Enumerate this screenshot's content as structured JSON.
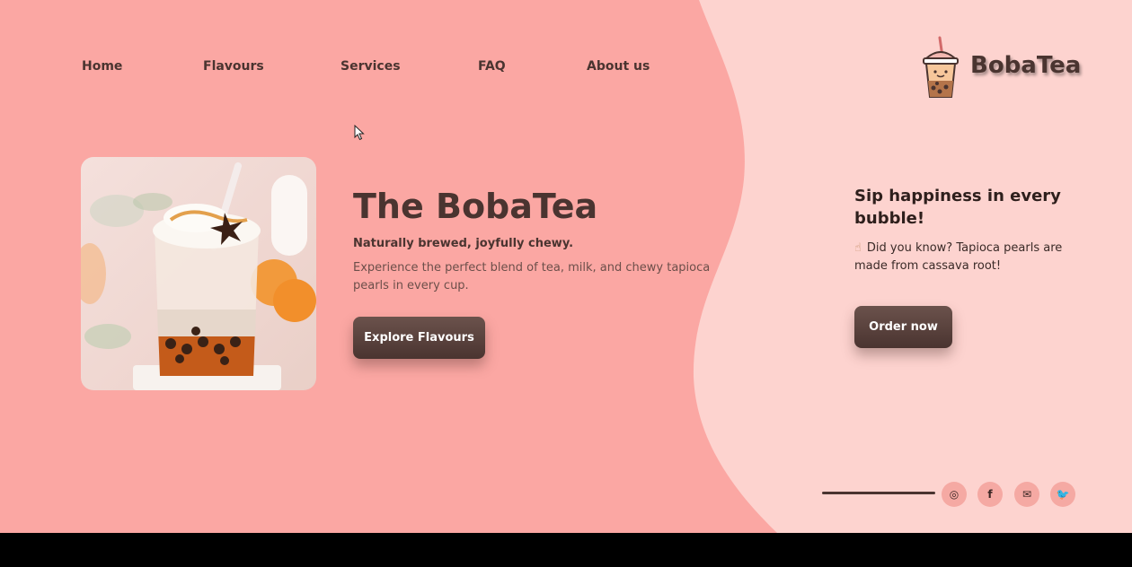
{
  "nav": {
    "items": [
      {
        "label": "Home"
      },
      {
        "label": "Flavours"
      },
      {
        "label": "Services"
      },
      {
        "label": "FAQ"
      },
      {
        "label": "About us"
      }
    ]
  },
  "brand": {
    "name": "BobaTea",
    "logo_icon": "boba-cup-icon"
  },
  "hero": {
    "title": "The BobaTea",
    "tagline": "Naturally brewed, joyfully chewy.",
    "description": "Experience the perfect blend of tea, milk, and chewy tapioca pearls in every cup.",
    "cta_label": "Explore Flavours",
    "image_icon": "bubble-tea-photo"
  },
  "side": {
    "heading": "Sip happiness in every bubble!",
    "fact_icon": "pointing-hand-icon",
    "fact": "Did you know? Tapioca pearls are made from cassava root!",
    "cta_label": "Order now"
  },
  "social": [
    {
      "name": "instagram-icon",
      "glyph": "◎"
    },
    {
      "name": "facebook-icon",
      "glyph": "f"
    },
    {
      "name": "email-icon",
      "glyph": "✉"
    },
    {
      "name": "twitter-icon",
      "glyph": "🐦"
    }
  ],
  "colors": {
    "background_pink": "#fba7a3",
    "panel_pink": "#fdd3cf",
    "brown": "#4a3430"
  }
}
